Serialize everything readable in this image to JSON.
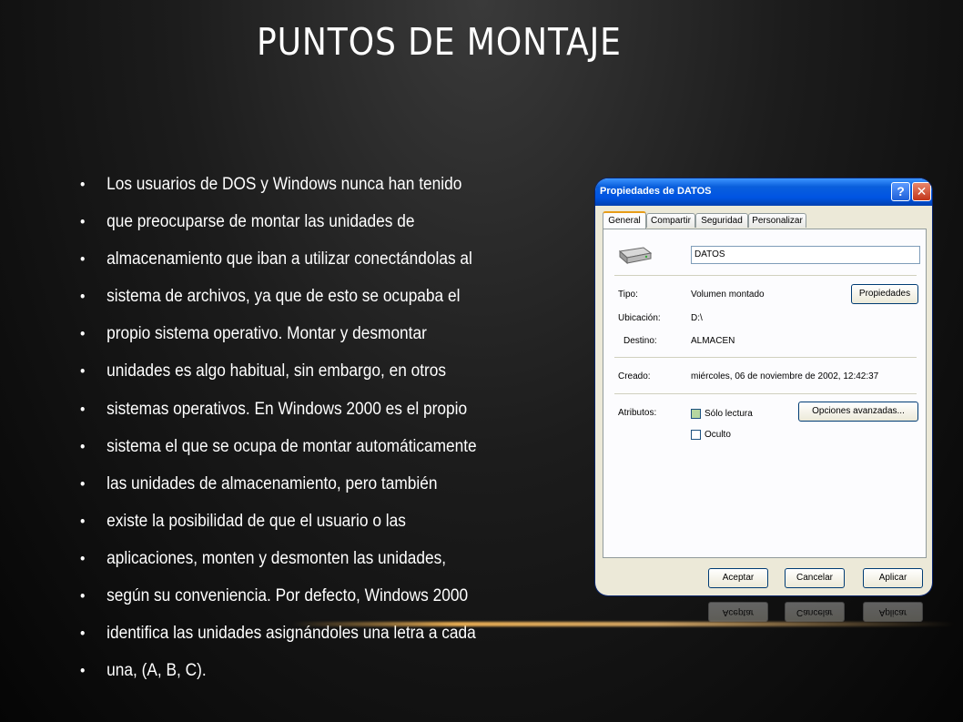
{
  "slide": {
    "title": "PUNTOS DE MONTAJE",
    "bullets": [
      "Los usuarios de DOS y Windows nunca han tenido",
      "que preocuparse de montar las unidades de",
      "almacenamiento que iban a utilizar conectándolas al",
      "sistema de archivos, ya que de esto se ocupaba el",
      "propio sistema operativo. Montar y desmontar",
      "unidades es algo habitual, sin embargo, en otros",
      "sistemas operativos. En Windows 2000 es el propio",
      "sistema el que se ocupa de montar automáticamente",
      "las unidades de almacenamiento, pero también",
      "existe la posibilidad de que el usuario o las",
      "aplicaciones, monten y desmonten las unidades,",
      "según su conveniencia. Por defecto, Windows 2000",
      "identifica las unidades asignándoles una letra a cada",
      "una, (A, B, C)."
    ]
  },
  "dialog": {
    "title": "Propiedades de DATOS",
    "help_glyph": "?",
    "close_glyph": "✕",
    "tabs": [
      "General",
      "Compartir",
      "Seguridad",
      "Personalizar"
    ],
    "name_value": "DATOS",
    "tipo_label": "Tipo:",
    "tipo_value": "Volumen montado",
    "propiedades_button": "Propiedades",
    "ubicacion_label": "Ubicación:",
    "ubicacion_value": "D:\\",
    "destino_label": "Destino:",
    "destino_value": "ALMACEN",
    "creado_label": "Creado:",
    "creado_value": "miércoles, 06 de noviembre de 2002, 12:42:37",
    "atributos_label": "Atributos:",
    "solo_lectura": "Sólo lectura",
    "oculto": "Oculto",
    "opciones_button": "Opciones avanzadas...",
    "aceptar_button": "Aceptar",
    "cancelar_button": "Cancelar",
    "aplicar_button": "Aplicar"
  }
}
